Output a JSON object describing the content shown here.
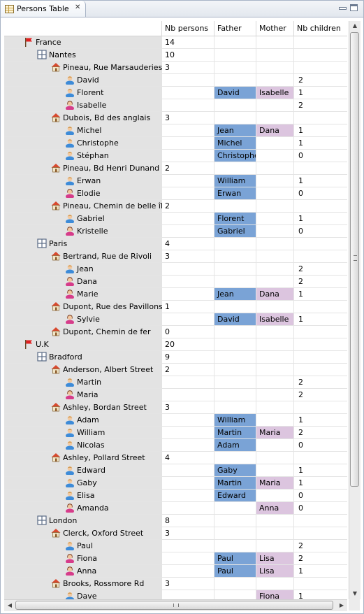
{
  "tab": {
    "title": "Persons Table",
    "icon": "table-icon",
    "close_icon": "close-icon"
  },
  "columns": [
    "",
    "Nb persons",
    "Father",
    "Mother",
    "Nb children"
  ],
  "colors": {
    "father_fill": "#7aa3d6",
    "mother_fill": "#dcc5df",
    "tree_column_bg": "#e3e3e3"
  },
  "rows": [
    {
      "level": 0,
      "type": "country",
      "name": "France",
      "persons": "14",
      "father": "",
      "mother": "",
      "children": ""
    },
    {
      "level": 1,
      "type": "city",
      "name": "Nantes",
      "persons": "10",
      "father": "",
      "mother": "",
      "children": ""
    },
    {
      "level": 2,
      "type": "house",
      "name": "Pineau, Rue Marsauderies",
      "persons": "3",
      "father": "",
      "mother": "",
      "children": ""
    },
    {
      "level": 3,
      "type": "man",
      "name": "David",
      "persons": "",
      "father": "",
      "mother": "",
      "children": "2"
    },
    {
      "level": 3,
      "type": "man",
      "name": "Florent",
      "persons": "",
      "father": "David",
      "mother": "Isabelle",
      "children": "1"
    },
    {
      "level": 3,
      "type": "woman",
      "name": "Isabelle",
      "persons": "",
      "father": "",
      "mother": "",
      "children": "2"
    },
    {
      "level": 2,
      "type": "house",
      "name": "Dubois, Bd des anglais",
      "persons": "3",
      "father": "",
      "mother": "",
      "children": ""
    },
    {
      "level": 3,
      "type": "man",
      "name": "Michel",
      "persons": "",
      "father": "Jean",
      "mother": "Dana",
      "children": "1"
    },
    {
      "level": 3,
      "type": "man",
      "name": "Christophe",
      "persons": "",
      "father": "Michel",
      "mother": "",
      "children": "1"
    },
    {
      "level": 3,
      "type": "man",
      "name": "Stéphan",
      "persons": "",
      "father": "Christophe",
      "mother": "",
      "children": "0"
    },
    {
      "level": 2,
      "type": "house",
      "name": "Pineau, Bd Henri Dunand",
      "persons": "2",
      "father": "",
      "mother": "",
      "children": ""
    },
    {
      "level": 3,
      "type": "man",
      "name": "Erwan",
      "persons": "",
      "father": "William",
      "mother": "",
      "children": "1"
    },
    {
      "level": 3,
      "type": "woman",
      "name": "Elodie",
      "persons": "",
      "father": "Erwan",
      "mother": "",
      "children": "0"
    },
    {
      "level": 2,
      "type": "house",
      "name": "Pineau, Chemin de belle île",
      "persons": "2",
      "father": "",
      "mother": "",
      "children": ""
    },
    {
      "level": 3,
      "type": "man",
      "name": "Gabriel",
      "persons": "",
      "father": "Florent",
      "mother": "",
      "children": "1"
    },
    {
      "level": 3,
      "type": "woman",
      "name": "Kristelle",
      "persons": "",
      "father": "Gabriel",
      "mother": "",
      "children": "0"
    },
    {
      "level": 1,
      "type": "city",
      "name": "Paris",
      "persons": "4",
      "father": "",
      "mother": "",
      "children": ""
    },
    {
      "level": 2,
      "type": "house",
      "name": "Bertrand, Rue de Rivoli",
      "persons": "3",
      "father": "",
      "mother": "",
      "children": ""
    },
    {
      "level": 3,
      "type": "man",
      "name": "Jean",
      "persons": "",
      "father": "",
      "mother": "",
      "children": "2"
    },
    {
      "level": 3,
      "type": "woman",
      "name": "Dana",
      "persons": "",
      "father": "",
      "mother": "",
      "children": "2"
    },
    {
      "level": 3,
      "type": "woman",
      "name": "Marie",
      "persons": "",
      "father": "Jean",
      "mother": "Dana",
      "children": "1"
    },
    {
      "level": 2,
      "type": "house",
      "name": "Dupont, Rue des Pavillons",
      "persons": "1",
      "father": "",
      "mother": "",
      "children": ""
    },
    {
      "level": 3,
      "type": "woman",
      "name": "Sylvie",
      "persons": "",
      "father": "David",
      "mother": "Isabelle",
      "children": "1"
    },
    {
      "level": 2,
      "type": "house",
      "name": "Dupont, Chemin de fer",
      "persons": "0",
      "father": "",
      "mother": "",
      "children": ""
    },
    {
      "level": 0,
      "type": "country",
      "name": "U.K",
      "persons": "20",
      "father": "",
      "mother": "",
      "children": ""
    },
    {
      "level": 1,
      "type": "city",
      "name": "Bradford",
      "persons": "9",
      "father": "",
      "mother": "",
      "children": ""
    },
    {
      "level": 2,
      "type": "house",
      "name": "Anderson, Albert Street",
      "persons": "2",
      "father": "",
      "mother": "",
      "children": ""
    },
    {
      "level": 3,
      "type": "man",
      "name": "Martin",
      "persons": "",
      "father": "",
      "mother": "",
      "children": "2"
    },
    {
      "level": 3,
      "type": "woman",
      "name": "Maria",
      "persons": "",
      "father": "",
      "mother": "",
      "children": "2"
    },
    {
      "level": 2,
      "type": "house",
      "name": "Ashley, Bordan Street",
      "persons": "3",
      "father": "",
      "mother": "",
      "children": ""
    },
    {
      "level": 3,
      "type": "man",
      "name": "Adam",
      "persons": "",
      "father": "William",
      "mother": "",
      "children": "1"
    },
    {
      "level": 3,
      "type": "man",
      "name": "William",
      "persons": "",
      "father": "Martin",
      "mother": "Maria",
      "children": "2"
    },
    {
      "level": 3,
      "type": "man",
      "name": "Nicolas",
      "persons": "",
      "father": "Adam",
      "mother": "",
      "children": "0"
    },
    {
      "level": 2,
      "type": "house",
      "name": "Ashley, Pollard Street",
      "persons": "4",
      "father": "",
      "mother": "",
      "children": ""
    },
    {
      "level": 3,
      "type": "man",
      "name": "Edward",
      "persons": "",
      "father": "Gaby",
      "mother": "",
      "children": "1"
    },
    {
      "level": 3,
      "type": "man",
      "name": "Gaby",
      "persons": "",
      "father": "Martin",
      "mother": "Maria",
      "children": "1"
    },
    {
      "level": 3,
      "type": "man",
      "name": "Elisa",
      "persons": "",
      "father": "Edward",
      "mother": "",
      "children": "0"
    },
    {
      "level": 3,
      "type": "woman",
      "name": "Amanda",
      "persons": "",
      "father": "",
      "mother": "Anna",
      "children": "0"
    },
    {
      "level": 1,
      "type": "city",
      "name": "London",
      "persons": "8",
      "father": "",
      "mother": "",
      "children": ""
    },
    {
      "level": 2,
      "type": "house",
      "name": "Clerck, Oxford Street",
      "persons": "3",
      "father": "",
      "mother": "",
      "children": ""
    },
    {
      "level": 3,
      "type": "man",
      "name": "Paul",
      "persons": "",
      "father": "",
      "mother": "",
      "children": "2"
    },
    {
      "level": 3,
      "type": "woman",
      "name": "Fiona",
      "persons": "",
      "father": "Paul",
      "mother": "Lisa",
      "children": "2"
    },
    {
      "level": 3,
      "type": "woman",
      "name": "Anna",
      "persons": "",
      "father": "Paul",
      "mother": "Lisa",
      "children": "1"
    },
    {
      "level": 2,
      "type": "house",
      "name": "Brooks, Rossmore Rd",
      "persons": "3",
      "father": "",
      "mother": "",
      "children": ""
    },
    {
      "level": 3,
      "type": "man",
      "name": "Dave",
      "persons": "",
      "father": "",
      "mother": "Fiona",
      "children": "1"
    }
  ]
}
